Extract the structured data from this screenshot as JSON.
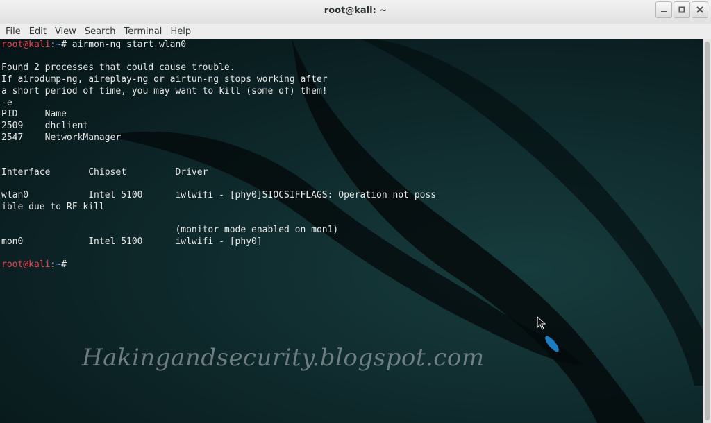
{
  "window": {
    "title": "root@kali: ~"
  },
  "menu": {
    "items": [
      "File",
      "Edit",
      "View",
      "Search",
      "Terminal",
      "Help"
    ]
  },
  "terminal": {
    "prompt_user": "root@kali",
    "prompt_sep": ":",
    "prompt_path": "~",
    "prompt_symbol": "# ",
    "command": "airmon-ng start wlan0",
    "output": "\n\nFound 2 processes that could cause trouble.\nIf airodump-ng, aireplay-ng or airtun-ng stops working after\na short period of time, you may want to kill (some of) them!\n-e\nPID\tName\n2509\tdhclient\n2547\tNetworkManager\n\n\nInterface\tChipset\t\tDriver\n\nwlan0\t\tIntel 5100\tiwlwifi - [phy0]SIOCSIFFLAGS: Operation not poss\nible due to RF-kill\n\n\t\t\t\t(monitor mode enabled on mon1)\nmon0\t\tIntel 5100\tiwlwifi - [phy0]\n\n"
  },
  "watermark": "Hakingandsecurity.blogspot.com",
  "colors": {
    "prompt_user": "#e8424f",
    "prompt_path": "#7aa4ff",
    "text": "#e6e6e6"
  },
  "icons": {
    "minimize": "minimize-icon",
    "maximize": "maximize-icon",
    "close": "close-icon",
    "pointer": "mouse-pointer-icon"
  }
}
